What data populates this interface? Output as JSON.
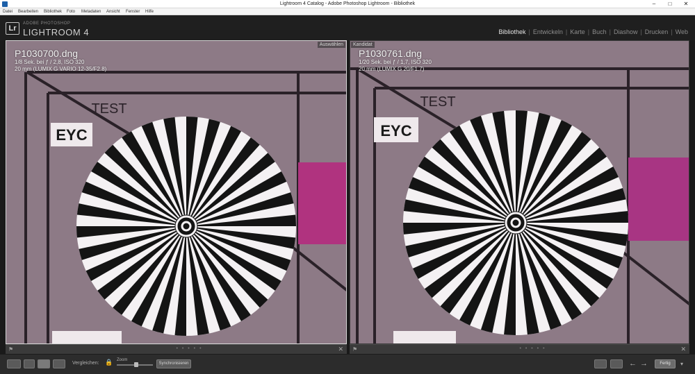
{
  "window": {
    "title": "Lightroom 4 Catalog - Adobe Photoshop Lightroom - Bibliothek"
  },
  "menu": [
    "Datei",
    "Bearbeiten",
    "Bibliothek",
    "Foto",
    "Metadaten",
    "Ansicht",
    "Fenster",
    "Hilfe"
  ],
  "brand": {
    "small": "ADOBE PHOTOSHOP",
    "big": "LIGHTROOM 4",
    "logo": "Lr"
  },
  "modules": [
    "Bibliothek",
    "Entwickeln",
    "Karte",
    "Buch",
    "Diashow",
    "Drucken",
    "Web"
  ],
  "active_module": "Bibliothek",
  "compare": {
    "select": {
      "tag": "Auswählen",
      "filename": "P1030700.dng",
      "exposure": "1/8 Sek. bei ƒ / 2,8, ISO 320",
      "lens": "20 mm (LUMIX G VARIO 12-35/F2.8)"
    },
    "candidate": {
      "tag": "Kandidat",
      "filename": "P1030761.dng",
      "exposure": "1/20 Sek. bei ƒ / 1,7, ISO 320",
      "lens": "20 mm (LUMIX G 20/F1.7)"
    }
  },
  "chart_text": {
    "test": "TEST",
    "eyc": "EYC"
  },
  "toolbar": {
    "compare_label": "Vergleichen:",
    "zoom_label": "Zoom",
    "sync_label": "Synchronisieren",
    "done_label": "Fertig"
  },
  "colors": {
    "background_photo": "#8d7a86",
    "magenta_patch": "#b0337f"
  }
}
